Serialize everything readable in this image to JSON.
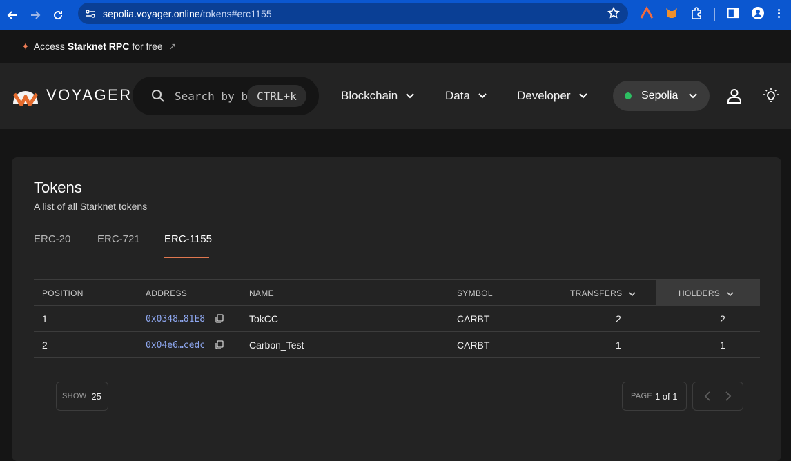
{
  "browser": {
    "url_host": "sepolia.voyager.online",
    "url_path": "/tokens#erc1155"
  },
  "promo": {
    "prefix": "Access",
    "bold": "Starknet RPC",
    "suffix": "for free"
  },
  "header": {
    "logo_text": "VOYAGER",
    "search_placeholder": "Search by b",
    "search_shortcut": "CTRL+k",
    "menu": [
      {
        "label": "Blockchain"
      },
      {
        "label": "Data"
      },
      {
        "label": "Developer"
      }
    ],
    "network": "Sepolia",
    "colors": {
      "network_dot": "#2dbf62",
      "accent": "#e0774f",
      "address_link": "#8ea7ef"
    }
  },
  "page": {
    "title": "Tokens",
    "subtitle": "A list of all Starknet tokens",
    "tabs": [
      {
        "label": "ERC-20",
        "active": false
      },
      {
        "label": "ERC-721",
        "active": false
      },
      {
        "label": "ERC-1155",
        "active": true
      }
    ]
  },
  "table": {
    "columns": [
      "POSITION",
      "ADDRESS",
      "NAME",
      "SYMBOL",
      "TRANSFERS",
      "HOLDERS"
    ],
    "rows": [
      {
        "position": "1",
        "address": "0x0348…81E8",
        "name": "TokCC",
        "symbol": "CARBT",
        "transfers": "2",
        "holders": "2"
      },
      {
        "position": "2",
        "address": "0x04e6…cedc",
        "name": "Carbon_Test",
        "symbol": "CARBT",
        "transfers": "1",
        "holders": "1"
      }
    ]
  },
  "pagination": {
    "show_label": "SHOW",
    "show_value": "25",
    "page_label": "PAGE",
    "page_value": "1 of 1"
  }
}
